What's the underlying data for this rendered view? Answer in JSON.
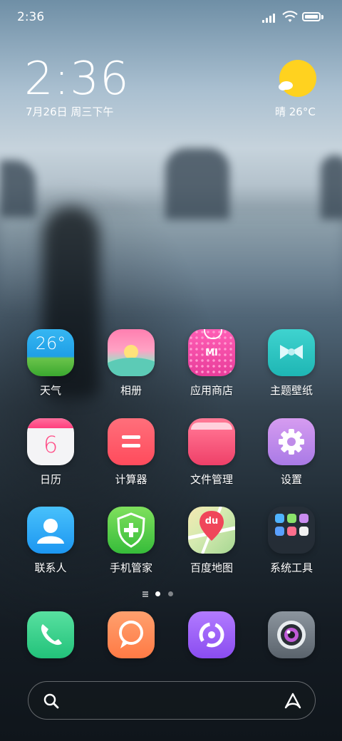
{
  "status_bar": {
    "time": "2:36"
  },
  "clock_widget": {
    "time": "2:36",
    "date": "7月26日 周三下午",
    "weather": "晴 26°C"
  },
  "apps": {
    "row1": [
      {
        "label": "天气",
        "icon": "weather-icon",
        "icon_text": "26°"
      },
      {
        "label": "相册",
        "icon": "gallery-icon"
      },
      {
        "label": "应用商店",
        "icon": "app-store-icon",
        "icon_text": "MI"
      },
      {
        "label": "主题壁纸",
        "icon": "themes-icon"
      }
    ],
    "row2": [
      {
        "label": "日历",
        "icon": "calendar-icon",
        "icon_text": "6"
      },
      {
        "label": "计算器",
        "icon": "calculator-icon"
      },
      {
        "label": "文件管理",
        "icon": "file-manager-icon"
      },
      {
        "label": "设置",
        "icon": "settings-gear-icon"
      }
    ],
    "row3": [
      {
        "label": "联系人",
        "icon": "contacts-icon"
      },
      {
        "label": "手机管家",
        "icon": "security-shield-icon"
      },
      {
        "label": "百度地图",
        "icon": "baidu-map-icon",
        "icon_text": "du"
      },
      {
        "label": "系统工具",
        "icon": "system-tools-folder-icon"
      }
    ]
  },
  "dock": [
    {
      "icon": "phone-icon"
    },
    {
      "icon": "messages-icon"
    },
    {
      "icon": "browser-icon"
    },
    {
      "icon": "camera-icon"
    }
  ],
  "page_indicator": {
    "pages": 2,
    "current": 1
  },
  "search": {
    "icon": "search-icon",
    "assistant_icon": "assistant-icon"
  }
}
